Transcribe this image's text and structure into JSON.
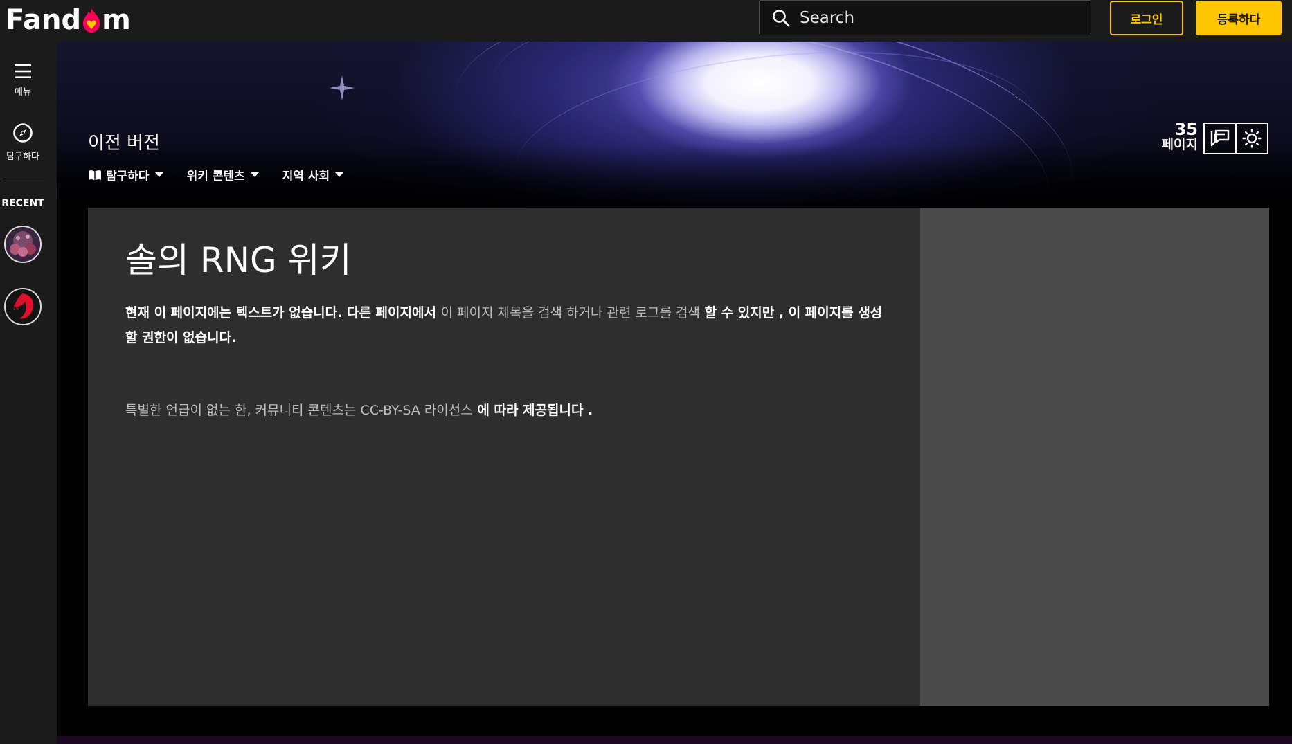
{
  "app": {
    "logo_text_left": "Fand",
    "logo_text_right": "m",
    "brand_color": "#ffc500",
    "flame_color": "#fa005a"
  },
  "header": {
    "search_placeholder": "Search",
    "login_label": "로그인",
    "register_label": "등록하다"
  },
  "rail": {
    "menu_label": "메뉴",
    "explore_label": "탐구하다",
    "recent_label": "RECENT"
  },
  "wiki": {
    "title": "이전 버전",
    "nav": [
      {
        "label": "탐구하다"
      },
      {
        "label": "위키 콘텐츠"
      },
      {
        "label": "지역 사회"
      }
    ],
    "page_count": "35",
    "page_count_unit": "페이지"
  },
  "content": {
    "heading": "솔의 RNG 위키",
    "para_part1": "현재 이 페이지에는 텍스트가 없습니다. 다른 페이지에서 ",
    "link_search_title": "이 페이지 제목을 검색",
    "para_part2": " 하거나 ",
    "link_search_logs": "관련 로그를 검색",
    "para_part3": " 할 수 있지만 , 이 페이지를 생성할 권한이 없습니다.",
    "license_part1": "특별한 언급이 없는 한, 커뮤니티 콘텐츠는 ",
    "license_link": "CC-BY-SA 라이선스",
    "license_part2": " 에 따라 제공됩니다 ."
  }
}
